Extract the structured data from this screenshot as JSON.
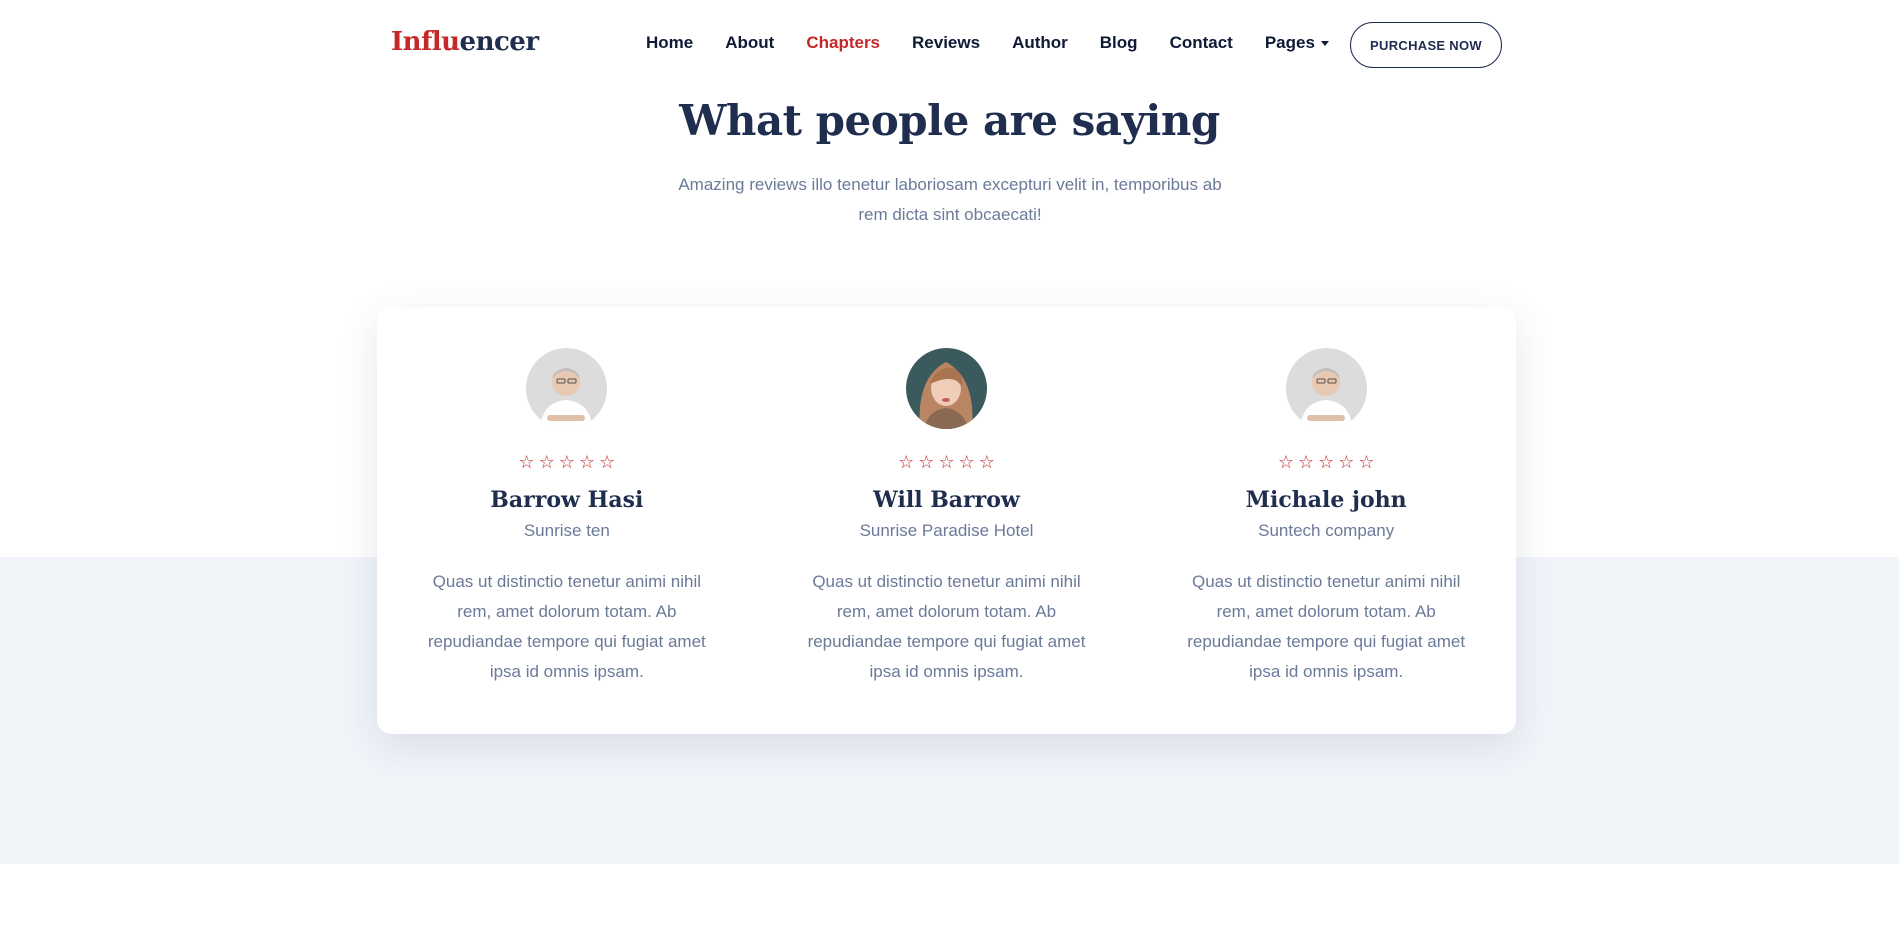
{
  "brand": {
    "logo_part1": "Influ",
    "logo_part2": "encer",
    "accent_color": "#c62828"
  },
  "nav": {
    "items": [
      {
        "label": "Home"
      },
      {
        "label": "About"
      },
      {
        "label": "Chapters",
        "active": true
      },
      {
        "label": "Reviews"
      },
      {
        "label": "Author"
      },
      {
        "label": "Blog"
      },
      {
        "label": "Contact"
      },
      {
        "label": "Pages",
        "dropdown": true
      }
    ],
    "purchase_label": "PURCHASE NOW"
  },
  "section": {
    "title": "What people are saying",
    "subtitle": "Amazing reviews illo tenetur laboriosam excepturi velit in, temporibus ab rem dicta sint obcaecati!"
  },
  "reviews": [
    {
      "avatar": "male-portrait",
      "stars": 5,
      "name": "Barrow Hasi",
      "company": "Sunrise ten",
      "quote": "Quas ut distinctio tenetur animi nihil rem, amet dolorum totam. Ab repudiandae tempore qui fugiat amet ipsa id omnis ipsam."
    },
    {
      "avatar": "female-portrait",
      "stars": 5,
      "name": "Will Barrow",
      "company": "Sunrise Paradise Hotel",
      "quote": "Quas ut distinctio tenetur animi nihil rem, amet dolorum totam. Ab repudiandae tempore qui fugiat amet ipsa id omnis ipsam."
    },
    {
      "avatar": "male-portrait",
      "stars": 5,
      "name": "Michale john",
      "company": "Suntech company",
      "quote": "Quas ut distinctio tenetur animi nihil rem, amet dolorum totam. Ab repudiandae tempore qui fugiat amet ipsa id omnis ipsam."
    }
  ],
  "star_glyph": "☆"
}
